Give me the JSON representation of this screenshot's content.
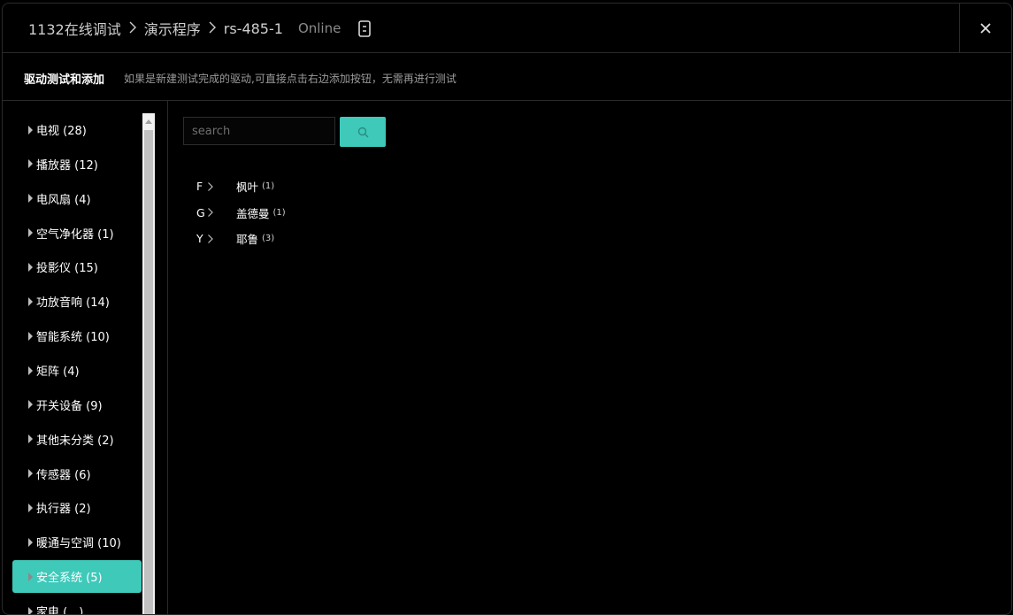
{
  "header": {
    "breadcrumb": [
      "1132在线调试",
      "演示程序",
      "rs-485-1"
    ],
    "status": "Online",
    "device_icon": "tablet-icon",
    "close_icon": "close-icon"
  },
  "subheader": {
    "title": "驱动测试和添加",
    "description": "如果是新建测试完成的驱动,可直接点击右边添加按钮，无需再进行测试"
  },
  "sidebar": {
    "items": [
      {
        "label": "电视 (28)"
      },
      {
        "label": "播放器 (12)"
      },
      {
        "label": "电风扇 (4)"
      },
      {
        "label": "空气净化器 (1)"
      },
      {
        "label": "投影仪 (15)"
      },
      {
        "label": "功放音响 (14)"
      },
      {
        "label": "智能系统 (10)"
      },
      {
        "label": "矩阵 (4)"
      },
      {
        "label": "开关设备 (9)"
      },
      {
        "label": "其他未分类 (2)"
      },
      {
        "label": "传感器 (6)"
      },
      {
        "label": "执行器 (2)"
      },
      {
        "label": "暖通与空调 (10)"
      },
      {
        "label": "安全系统 (5)",
        "active": true
      },
      {
        "label": "家电 (…)"
      }
    ]
  },
  "search": {
    "placeholder": "search",
    "value": "",
    "button_icon": "search-icon"
  },
  "brands": [
    {
      "letter": "F",
      "name": "枫叶",
      "count": "(1)"
    },
    {
      "letter": "G",
      "name": "盖德曼",
      "count": "(1)"
    },
    {
      "letter": "Y",
      "name": "耶鲁",
      "count": "(3)"
    }
  ],
  "colors": {
    "accent": "#3ec9b9",
    "background": "#000000",
    "border": "#2a2a2a",
    "muted_text": "#9a9a9a"
  }
}
